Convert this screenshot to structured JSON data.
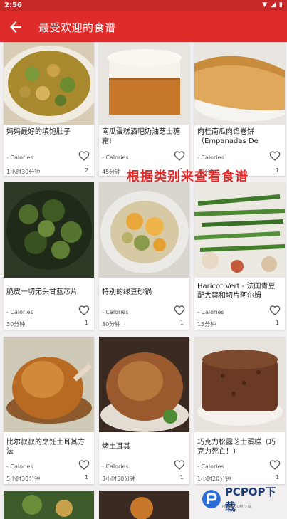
{
  "status": {
    "time": "2:56"
  },
  "header": {
    "title": "最受欢迎的食谱"
  },
  "overlay_text": "根据类别来查看食谱",
  "watermark": {
    "text": "PCPOP下载",
    "sub": "PCPOP.COM 下载"
  },
  "recipes": [
    {
      "name1": "妈妈最好的填饱肚子",
      "name2": "",
      "calories": "- Calories",
      "time": "1小时30分钟",
      "count": "2"
    },
    {
      "name1": "南瓜蛋糕酒吧奶油芝士糖",
      "name2": "霜!",
      "calories": "- Calories",
      "time": "45分钟",
      "count": "1"
    },
    {
      "name1": "肉桂南瓜肉馅卷饼",
      "name2": "（Empanadas De",
      "calories": "- Calories",
      "time": "40分钟",
      "count": "1"
    },
    {
      "name1": "脆皮一切无头甘蓝芯片",
      "name2": "",
      "calories": "- Calories",
      "time": "30分钟",
      "count": "1"
    },
    {
      "name1": "特别的绿豆砂锅",
      "name2": "",
      "calories": "- Calories",
      "time": "30分钟",
      "count": "1"
    },
    {
      "name1": "Haricot Vert - 法国青豆",
      "name2": "配大蒜和切片阿尔姆",
      "calories": "- Calories",
      "time": "15分钟",
      "count": "1"
    },
    {
      "name1": "比尔叔叔的烹饪土耳其方",
      "name2": "法",
      "calories": "- Calories",
      "time": "5小时30分钟",
      "count": "1"
    },
    {
      "name1": "烤土耳其",
      "name2": "",
      "calories": "- Calories",
      "time": "3小时50分钟",
      "count": "1"
    },
    {
      "name1": "巧克力松露芝士蛋糕（巧",
      "name2": "克力死亡！）",
      "calories": "- Calories",
      "time": "1小时20分钟",
      "count": "1"
    }
  ],
  "colors": {
    "primary": "#e02b2b",
    "status_bar": "#c62828",
    "background": "#f1eff0"
  }
}
